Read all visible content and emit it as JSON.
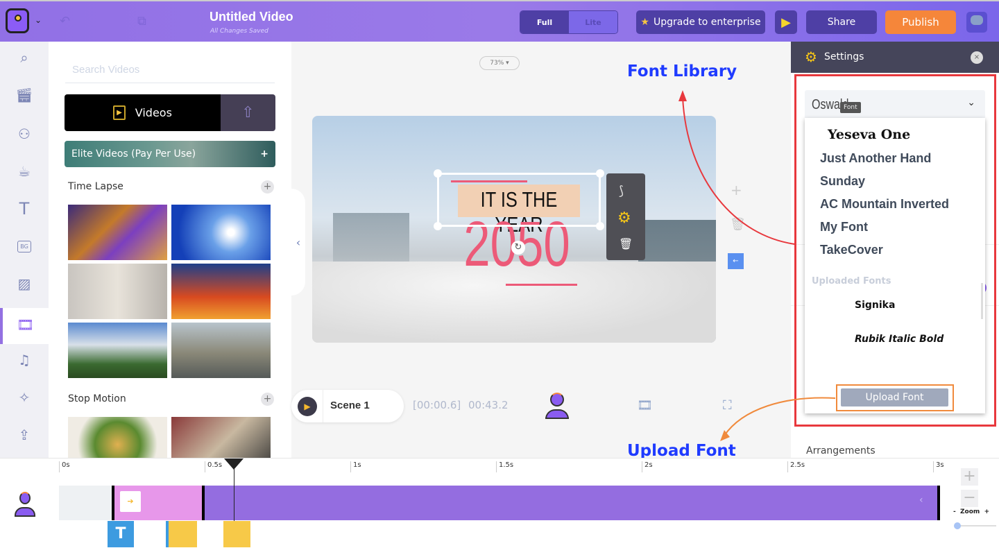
{
  "header": {
    "title": "Untitled Video",
    "subtitle": "All Changes Saved",
    "mode_full": "Full",
    "mode_lite": "Lite",
    "upgrade": "Upgrade to enterprise",
    "share": "Share",
    "publish": "Publish"
  },
  "rail": {
    "icons": [
      "search-icon",
      "clapperboard-icon",
      "character-icon",
      "coffee-icon",
      "text-icon",
      "background-icon",
      "image-icon",
      "video-icon",
      "music-icon",
      "effects-icon",
      "upload-icon"
    ],
    "bg_label": "BG"
  },
  "panel": {
    "search_placeholder": "Search Videos",
    "videos_tab": "Videos",
    "elite": "Elite Videos (Pay Per Use)",
    "sections": [
      {
        "title": "Time Lapse"
      },
      {
        "title": "Stop Motion"
      }
    ]
  },
  "canvas": {
    "zoom": "73%",
    "line1": "IT IS THE YEAR",
    "line2": "2050"
  },
  "scene": {
    "name": "Scene 1",
    "elapsed": "[00:00.6]",
    "duration": "00:43.2"
  },
  "settings": {
    "title": "Settings",
    "selected_font": "Oswald",
    "tooltip": "Font",
    "fonts": [
      "Yeseva One",
      "Just Another Hand",
      "Sunday",
      "AC Mountain Inverted",
      "My Font",
      "TakeCover"
    ],
    "uploaded_label": "Uploaded Fonts",
    "uploaded": [
      "Signika",
      "Rubik Italic Bold"
    ],
    "upload_button": "Upload Font",
    "arrangements": "Arrangements"
  },
  "annotations": {
    "font_library": "Font Library",
    "upload_font": "Upload Font"
  },
  "timeline": {
    "ticks": [
      "0s",
      "0.5s",
      "1s",
      "1.5s",
      "2s",
      "2.5s",
      "3s"
    ],
    "playhead_seconds": 0.6,
    "zoom_label": "Zoom",
    "zoom_minus": "-",
    "zoom_plus": "+",
    "text_marker": "T"
  },
  "colors": {
    "accent": "#9370e2",
    "publish": "#f5863a",
    "highlight": "#e8383d",
    "upload_annot": "#f08a3c",
    "title_pink": "#ec5a78"
  }
}
